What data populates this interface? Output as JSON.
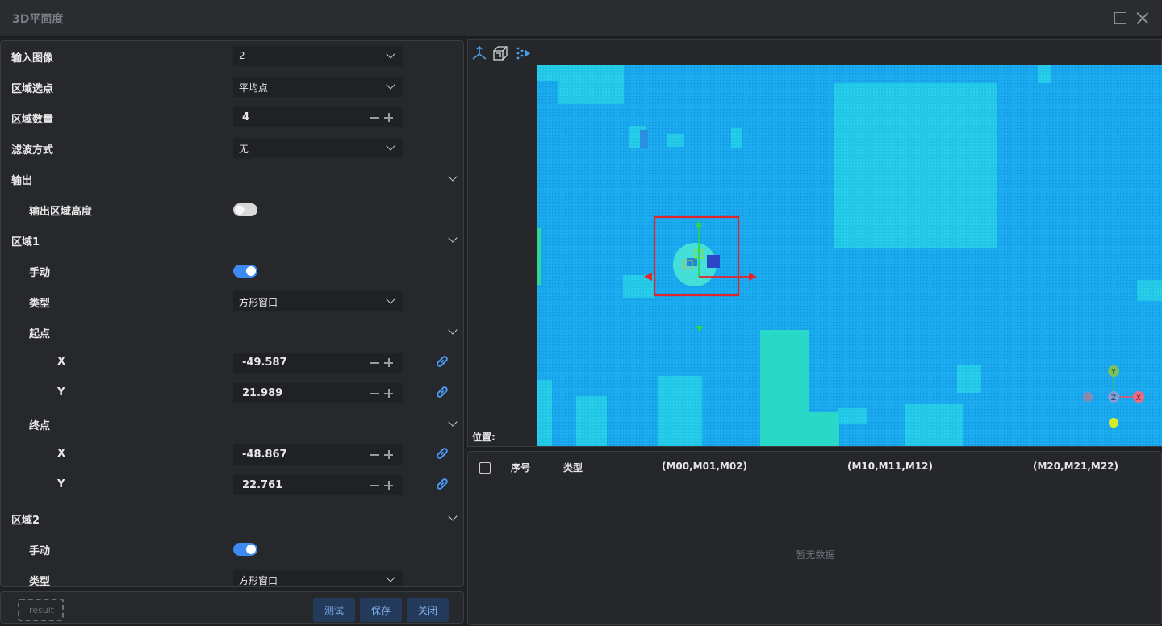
{
  "window": {
    "title": "3D平面度"
  },
  "params": {
    "input_image": {
      "label": "输入图像",
      "value": "2"
    },
    "region_pick": {
      "label": "区域选点",
      "value": "平均点"
    },
    "region_count": {
      "label": "区域数量",
      "value": "4"
    },
    "filter": {
      "label": "滤波方式",
      "value": "无"
    },
    "output": {
      "label": "输出",
      "height_label": "输出区域高度",
      "height_enabled": false
    },
    "region1": {
      "label": "区域1",
      "manual_label": "手动",
      "manual": true,
      "type_label": "类型",
      "type_value": "方形窗口",
      "start_label": "起点",
      "start_x_label": "X",
      "start_x": "-49.587",
      "start_y_label": "Y",
      "start_y": "21.989",
      "end_label": "终点",
      "end_x_label": "X",
      "end_x": "-48.867",
      "end_y_label": "Y",
      "end_y": "22.761"
    },
    "region2": {
      "label": "区域2",
      "manual_label": "手动",
      "manual": true,
      "type_label": "类型",
      "type_value": "方形窗口"
    }
  },
  "footer": {
    "result_label": "result",
    "test_label": "测试",
    "save_label": "保存",
    "close_label": "关闭"
  },
  "viewer": {
    "position_label": "位置:",
    "axis_x": "X",
    "axis_y": "Y",
    "axis_z": "Z"
  },
  "table": {
    "headers": [
      "序号",
      "类型",
      "(M00,M01,M02)",
      "(M10,M11,M12)",
      "(M20,M21,M22)"
    ],
    "empty_text": "暂无数据"
  },
  "colors": {
    "accent": "#3d8bf2",
    "pointcloud": "#1aa3ee",
    "roi": "#e8272a",
    "button_bg": "#243a5a",
    "button_text": "#7fb0ee"
  },
  "icons": [
    "axis-icon",
    "cube-view-icon",
    "points-icon",
    "link-icon",
    "close-icon",
    "maximize-icon"
  ]
}
